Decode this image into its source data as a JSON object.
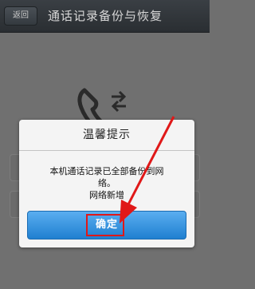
{
  "header": {
    "back_label": "返回",
    "title": "通话记录备份与恢复"
  },
  "dialog": {
    "title": "温馨提示",
    "message_line1": "本机通话记录已全部备份到网",
    "message_line2": "络。",
    "message_line3": "网络新增",
    "ok_label": "确定"
  },
  "colors": {
    "accent_blue": "#2b8ee0",
    "annotation_red": "#e01818"
  },
  "icons": {
    "background_icon": "phone-transfer-icon"
  }
}
